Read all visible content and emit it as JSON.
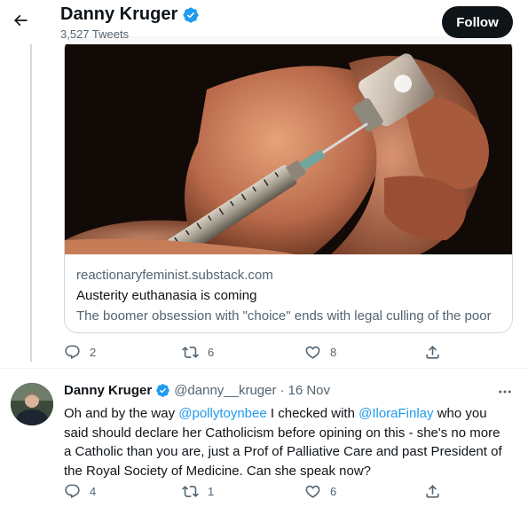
{
  "header": {
    "profile_name": "Danny Kruger",
    "tweet_count": "3,527 Tweets",
    "follow_label": "Follow"
  },
  "card": {
    "domain": "reactionaryfeminist.substack.com",
    "title": "Austerity euthanasia is coming",
    "description": "The boomer obsession with \"choice\" ends with legal culling of the poor"
  },
  "tweet1_stats": {
    "replies": "2",
    "retweets": "6",
    "likes": "8"
  },
  "tweet2": {
    "name": "Danny Kruger",
    "handle": "@danny__kruger",
    "separator": "·",
    "time": "16 Nov",
    "text_part1": "Oh and by the way ",
    "mention1": "@pollytoynbee",
    "text_part2": " I checked with ",
    "mention2": "@IloraFinlay",
    "text_part3": " who you said should declare her Catholicism before opining on this - she's no more a Catholic than you are, just a Prof of Palliative Care and past President of the Royal Society of Medicine. Can she speak now?",
    "replies": "4",
    "retweets": "1",
    "likes": "6"
  },
  "icons": {
    "back": "arrow-left-icon",
    "verified": "verified-badge-icon",
    "reply": "reply-icon",
    "retweet": "retweet-icon",
    "like": "heart-icon",
    "share": "share-icon",
    "more": "more-icon"
  },
  "colors": {
    "accent": "#1d9bf0",
    "text": "#0f1419",
    "secondary": "#536471",
    "border": "#cfd9de"
  }
}
